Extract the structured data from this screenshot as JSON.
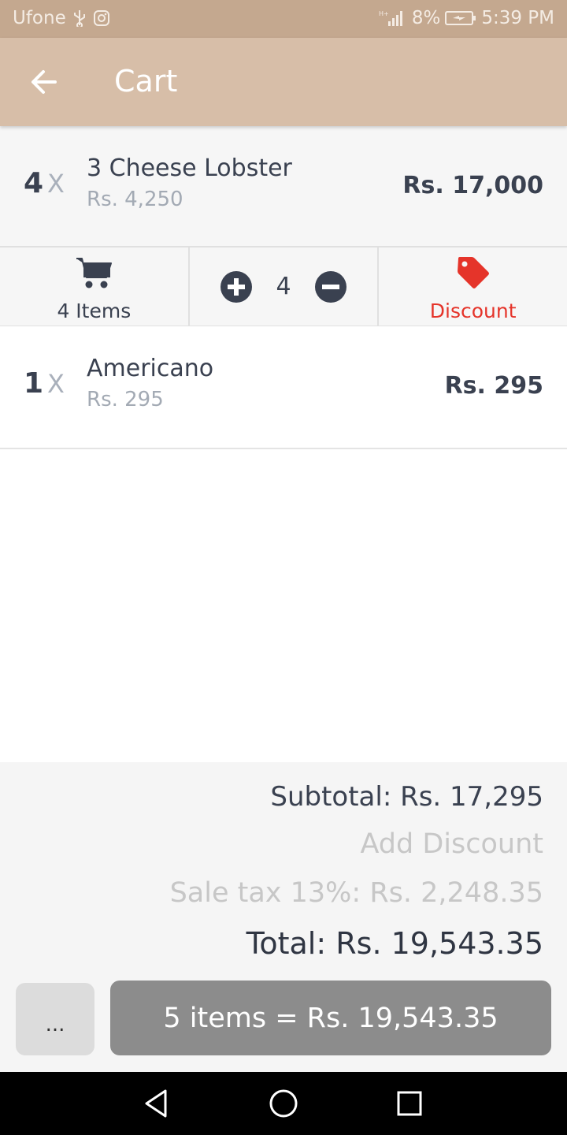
{
  "status_bar": {
    "carrier": "Ufone",
    "battery": "8%",
    "time": "5:39 PM",
    "icons": [
      "usb-icon",
      "instagram-icon",
      "signal-icon",
      "battery-icon"
    ]
  },
  "app_bar": {
    "title": "Cart",
    "back_icon": "arrow-left-icon"
  },
  "cart_items": [
    {
      "qty": "4",
      "x": "X",
      "name": "3 Cheese Lobster",
      "unit_price": "Rs. 4,250",
      "line_total": "Rs. 17,000"
    },
    {
      "qty": "1",
      "x": "X",
      "name": "Americano",
      "unit_price": "Rs. 295",
      "line_total": "Rs. 295"
    }
  ],
  "action_bar": {
    "items_label": "4 Items",
    "stepper_value": "4",
    "discount_label": "Discount",
    "icons": [
      "cart-icon",
      "plus-circle-icon",
      "minus-circle-icon",
      "tag-icon"
    ]
  },
  "summary": {
    "subtotal": "Subtotal: Rs. 17,295",
    "add_discount": "Add Discount",
    "sale_tax": "Sale tax 13%: Rs. 2,248.35",
    "total": "Total: Rs. 19,543.35"
  },
  "footer": {
    "more_label": "...",
    "checkout_label": "5 items = Rs. 19,543.35"
  },
  "colors": {
    "status_bar": "#c4a88f",
    "app_bar": "#d7bea8",
    "discount_red": "#e5342a",
    "checkout_button": "#8c8c8c",
    "text_dark": "#3a4150"
  }
}
